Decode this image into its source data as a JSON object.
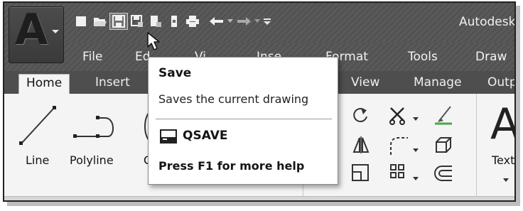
{
  "window": {
    "title": "Autodesk"
  },
  "app_button": {
    "letter": "A"
  },
  "quick_access": [
    {
      "name": "new-icon"
    },
    {
      "name": "open-icon"
    },
    {
      "name": "save-icon",
      "active": true
    },
    {
      "name": "save-as-icon"
    },
    {
      "name": "export-icon"
    },
    {
      "name": "publish-icon"
    },
    {
      "name": "plot-icon"
    },
    {
      "name": "undo-icon"
    },
    {
      "name": "redo-icon"
    },
    {
      "name": "customize-icon"
    }
  ],
  "menubar": {
    "items": [
      "File",
      "Ed",
      "Vi",
      "Inse",
      "Format",
      "Tools",
      "Draw"
    ]
  },
  "ribbon_tabs": {
    "items": [
      "Home",
      "Insert",
      "View",
      "Manage",
      "Outp"
    ],
    "active": "Home"
  },
  "ribbon": {
    "line_label": "Line",
    "polyline_label": "Polyline",
    "circle_label": "C",
    "text_label": "Text",
    "text_glyph": "A"
  },
  "tooltip": {
    "title": "Save",
    "description": "Saves the current drawing",
    "command": "QSAVE",
    "help": "Press F1 for more help"
  },
  "colors": {
    "titlebar": "#555555",
    "ribbon_tabs": "#4e4e4e",
    "ribbon_panel": "#f4f4f4",
    "tooltip_bg": "#ffffff"
  }
}
